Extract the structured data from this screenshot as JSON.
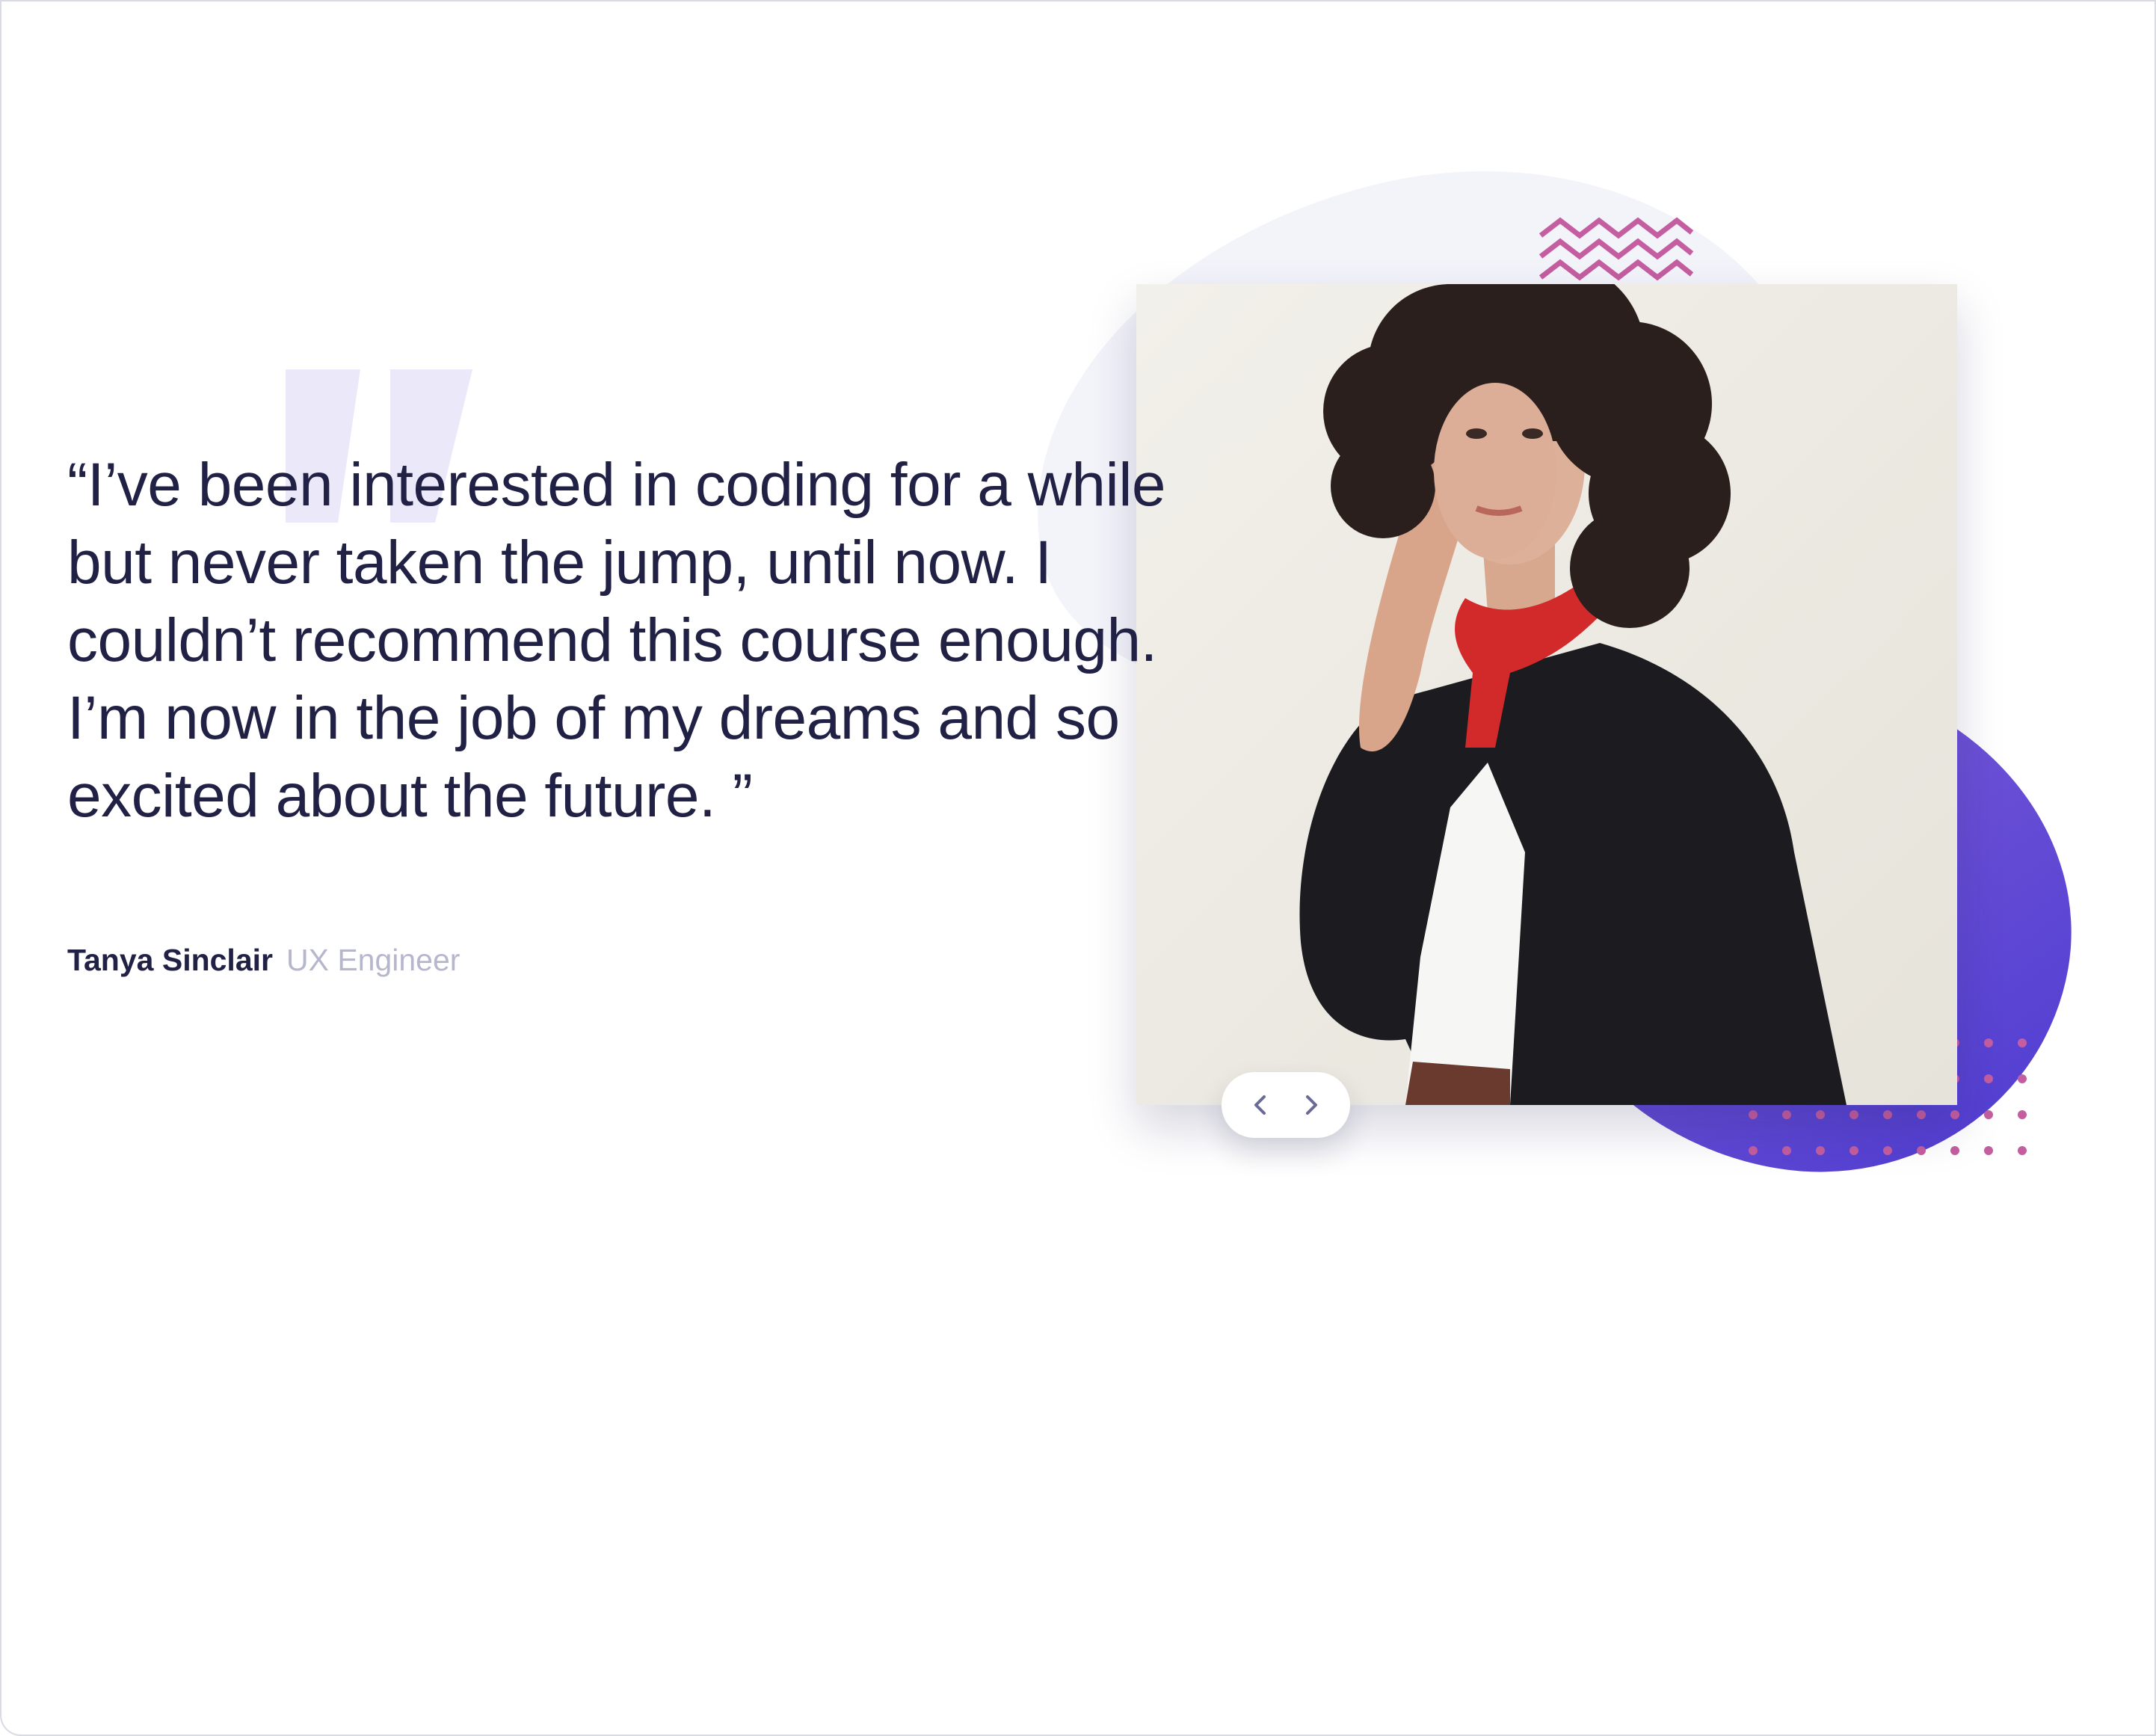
{
  "testimonial": {
    "quote": "“I’ve been interested in coding for a while but never taken the jump, until now. I couldn’t recommend this course enough. I’m now in the job of my dreams and so excited about the future. ”",
    "author_name": "Tanya Sinclair",
    "author_role": "UX Engineer"
  },
  "navigation": {
    "prev_icon": "chevron-left-icon",
    "next_icon": "chevron-right-icon"
  },
  "colors": {
    "text_dark": "#202145",
    "text_muted": "#b6b6cd",
    "accent_purple": "#6b50d6",
    "accent_pink": "#c45ea0",
    "bg_quote_mark": "#ebe8fa"
  }
}
